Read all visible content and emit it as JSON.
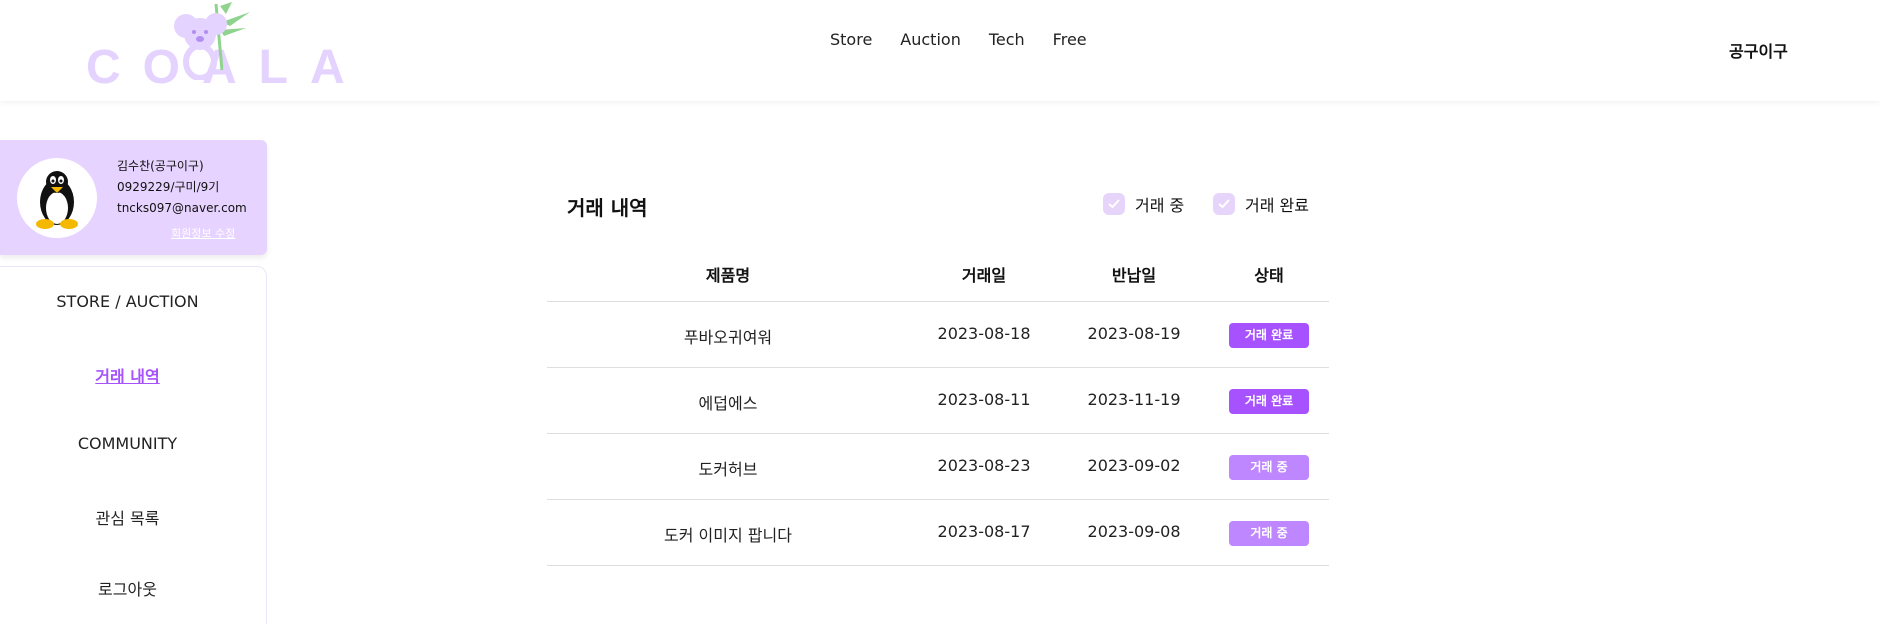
{
  "header": {
    "logo_text": "COALA",
    "nav": [
      "Store",
      "Auction",
      "Tech",
      "Free"
    ],
    "user_name": "공구이구"
  },
  "profile": {
    "name": "김수찬(공구이구)",
    "info": "0929229/구미/9기",
    "email": "tncks097@naver.com",
    "edit_label": "회원정보 수정"
  },
  "sidebar": {
    "items": [
      {
        "label": "STORE / AUCTION"
      },
      {
        "label": "거래 내역"
      },
      {
        "label": "COMMUNITY"
      },
      {
        "label": "관심 목록"
      },
      {
        "label": "로그아웃"
      }
    ]
  },
  "main": {
    "title": "거래 내역",
    "filters": [
      "거래 중",
      "거래 완료"
    ],
    "columns": [
      "제품명",
      "거래일",
      "반납일",
      "상태"
    ],
    "rows": [
      {
        "product": "푸바오귀여워",
        "trade_date": "2023-08-18",
        "return_date": "2023-08-19",
        "status": "거래 완료"
      },
      {
        "product": "에덥에스",
        "trade_date": "2023-08-11",
        "return_date": "2023-11-19",
        "status": "거래 완료"
      },
      {
        "product": "도커허브",
        "trade_date": "2023-08-23",
        "return_date": "2023-09-02",
        "status": "거래 중"
      },
      {
        "product": "도커 이미지 팝니다",
        "trade_date": "2023-08-17",
        "return_date": "2023-09-08",
        "status": "거래 중"
      }
    ]
  },
  "colors": {
    "accent": "#a653ff",
    "badge_done": "#a653ff",
    "badge_ongoing": "#bf87ff",
    "profile_bg": "#e7d3ff",
    "checkbox": "#e6d4fb"
  }
}
